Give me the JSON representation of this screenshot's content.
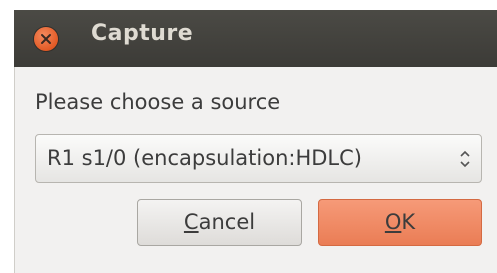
{
  "window": {
    "title": "Capture"
  },
  "dialog": {
    "prompt": "Please choose a source",
    "source_select": {
      "value": "R1 s1/0 (encapsulation:HDLC)"
    },
    "buttons": {
      "cancel_mnemonic": "C",
      "cancel_rest": "ancel",
      "ok_mnemonic": "O",
      "ok_rest": "K"
    }
  },
  "colors": {
    "titlebar": "#3c3b37",
    "close_button": "#e25a25",
    "ok_button": "#ea7d55",
    "dialog_background": "#f2f1f0"
  }
}
